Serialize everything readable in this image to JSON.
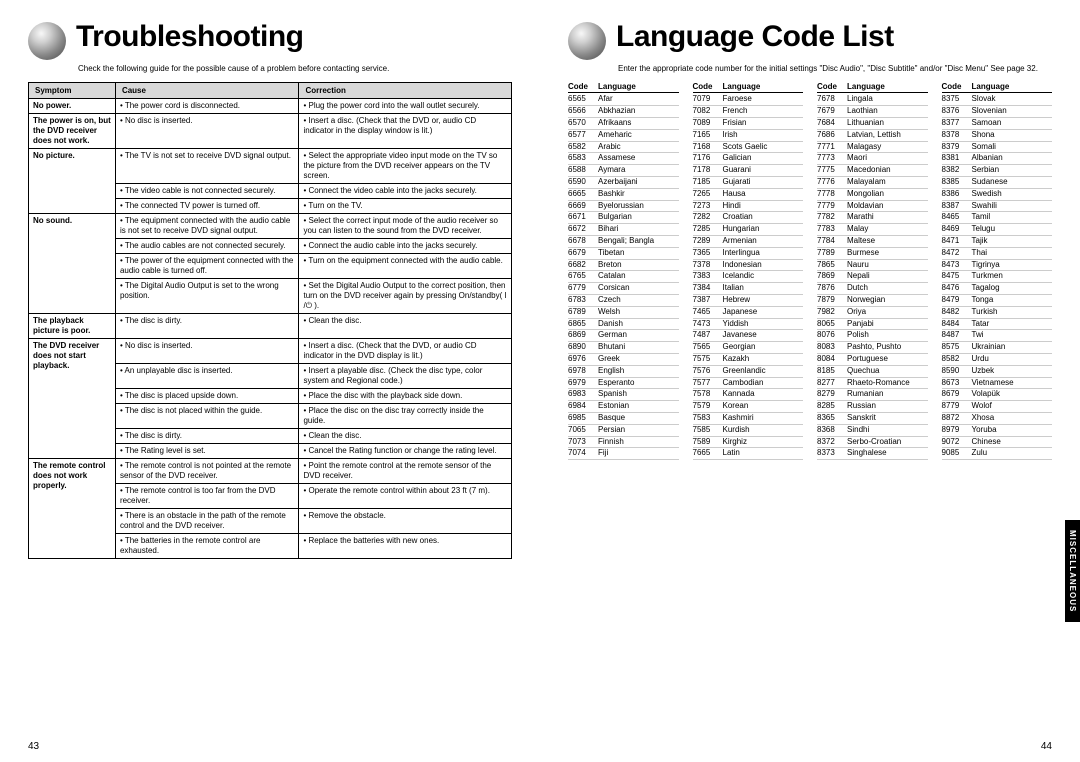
{
  "left": {
    "title": "Troubleshooting",
    "intro": "Check the following guide for the possible cause of a problem before contacting service.",
    "headers": {
      "symptom": "Symptom",
      "cause": "Cause",
      "correction": "Correction"
    },
    "rows": [
      {
        "symptom": "No power.",
        "items": [
          {
            "cause": "The power cord is disconnected.",
            "corr": "Plug the power cord into the wall outlet securely."
          }
        ]
      },
      {
        "symptom": "The power is on, but the DVD receiver does not work.",
        "items": [
          {
            "cause": "No disc is inserted.",
            "corr": "Insert a disc. (Check that the DVD or, audio CD indicator in the display window is lit.)"
          }
        ]
      },
      {
        "symptom": "No picture.",
        "items": [
          {
            "cause": "The TV is not set to receive DVD signal output.",
            "corr": "Select the appropriate video input mode on the TV so the picture from the DVD receiver appears on the TV screen."
          },
          {
            "cause": "The video cable is not connected securely.",
            "corr": "Connect the video cable into the jacks securely."
          },
          {
            "cause": "The connected TV power is turned off.",
            "corr": "Turn on the TV."
          }
        ]
      },
      {
        "symptom": "No sound.",
        "items": [
          {
            "cause": "The equipment connected with the audio cable is not set to receive DVD signal output.",
            "corr": "Select the correct input mode of the audio receiver so you can listen to the sound from the DVD receiver."
          },
          {
            "cause": "The audio cables are not connected securely.",
            "corr": "Connect the audio cable into the jacks securely."
          },
          {
            "cause": "The power of the equipment connected with the audio cable is turned off.",
            "corr": "Turn on the equipment connected with the audio cable."
          },
          {
            "cause": "The Digital Audio Output is set to the wrong position.",
            "corr": "Set the Digital Audio Output to the correct position, then turn on the DVD receiver again by pressing On/standby( I /⏻ )."
          }
        ]
      },
      {
        "symptom": "The playback picture is poor.",
        "items": [
          {
            "cause": "The disc is dirty.",
            "corr": "Clean the disc."
          }
        ]
      },
      {
        "symptom": "The DVD receiver does not start playback.",
        "items": [
          {
            "cause": "No disc is inserted.",
            "corr": "Insert a disc. (Check that the DVD, or audio CD indicator in the DVD display is lit.)"
          },
          {
            "cause": "An unplayable disc is inserted.",
            "corr": "Insert a playable disc. (Check the disc type, color system and Regional code.)"
          },
          {
            "cause": "The disc is placed upside down.",
            "corr": "Place the disc with the playback side down."
          },
          {
            "cause": "The disc is not placed within the guide.",
            "corr": "Place the disc on the disc tray correctly inside the guide."
          },
          {
            "cause": "The disc is dirty.",
            "corr": "Clean the disc."
          },
          {
            "cause": "The Rating level is set.",
            "corr": "Cancel the Rating function or change the rating  level."
          }
        ]
      },
      {
        "symptom": "The remote control does not work properly.",
        "items": [
          {
            "cause": "The remote control is not pointed at the remote sensor of the DVD receiver.",
            "corr": "Point the remote control at the remote sensor of the DVD receiver."
          },
          {
            "cause": "The remote control is too far from the DVD receiver.",
            "corr": "Operate the remote control within about 23 ft (7 m)."
          },
          {
            "cause": "There is an obstacle in the path of the remote control and the DVD receiver.",
            "corr": "Remove the obstacle."
          },
          {
            "cause": "The batteries in the remote control are exhausted.",
            "corr": "Replace the batteries with new ones."
          }
        ]
      }
    ],
    "pageNum": "43"
  },
  "right": {
    "title": "Language Code List",
    "intro": "Enter the appropriate code number for the initial settings \"Disc Audio\", \"Disc Subtitle\" and/or \"Disc Menu\"  See page 32.",
    "headers": {
      "code": "Code",
      "language": "Language"
    },
    "cols": [
      [
        {
          "c": "6565",
          "l": "Afar"
        },
        {
          "c": "6566",
          "l": "Abkhazian"
        },
        {
          "c": "6570",
          "l": "Afrikaans"
        },
        {
          "c": "6577",
          "l": "Ameharic"
        },
        {
          "c": "6582",
          "l": "Arabic"
        },
        {
          "c": "6583",
          "l": "Assamese"
        },
        {
          "c": "6588",
          "l": "Aymara"
        },
        {
          "c": "6590",
          "l": "Azerbaijani"
        },
        {
          "c": "6665",
          "l": "Bashkir"
        },
        {
          "c": "6669",
          "l": "Byelorussian"
        },
        {
          "c": "6671",
          "l": "Bulgarian"
        },
        {
          "c": "6672",
          "l": "Bihari"
        },
        {
          "c": "6678",
          "l": "Bengali; Bangla"
        },
        {
          "c": "6679",
          "l": "Tibetan"
        },
        {
          "c": "6682",
          "l": "Breton"
        },
        {
          "c": "6765",
          "l": "Catalan"
        },
        {
          "c": "6779",
          "l": "Corsican"
        },
        {
          "c": "6783",
          "l": "Czech"
        },
        {
          "c": "6789",
          "l": "Welsh"
        },
        {
          "c": "6865",
          "l": "Danish"
        },
        {
          "c": "6869",
          "l": "German"
        },
        {
          "c": "6890",
          "l": "Bhutani"
        },
        {
          "c": "6976",
          "l": "Greek"
        },
        {
          "c": "6978",
          "l": "English"
        },
        {
          "c": "6979",
          "l": "Esperanto"
        },
        {
          "c": "6983",
          "l": "Spanish"
        },
        {
          "c": "6984",
          "l": "Estonian"
        },
        {
          "c": "6985",
          "l": "Basque"
        },
        {
          "c": "7065",
          "l": "Persian"
        },
        {
          "c": "7073",
          "l": "Finnish"
        },
        {
          "c": "7074",
          "l": "Fiji"
        }
      ],
      [
        {
          "c": "7079",
          "l": "Faroese"
        },
        {
          "c": "7082",
          "l": "French"
        },
        {
          "c": "7089",
          "l": "Frisian"
        },
        {
          "c": "7165",
          "l": "Irish"
        },
        {
          "c": "7168",
          "l": "Scots Gaelic"
        },
        {
          "c": "7176",
          "l": "Galician"
        },
        {
          "c": "7178",
          "l": "Guarani"
        },
        {
          "c": "7185",
          "l": "Gujarati"
        },
        {
          "c": "7265",
          "l": "Hausa"
        },
        {
          "c": "7273",
          "l": "Hindi"
        },
        {
          "c": "7282",
          "l": "Croatian"
        },
        {
          "c": "7285",
          "l": "Hungarian"
        },
        {
          "c": "7289",
          "l": "Armenian"
        },
        {
          "c": "7365",
          "l": "Interlingua"
        },
        {
          "c": "7378",
          "l": "Indonesian"
        },
        {
          "c": "7383",
          "l": "Icelandic"
        },
        {
          "c": "7384",
          "l": "Italian"
        },
        {
          "c": "7387",
          "l": "Hebrew"
        },
        {
          "c": "7465",
          "l": "Japanese"
        },
        {
          "c": "7473",
          "l": "Yiddish"
        },
        {
          "c": "7487",
          "l": "Javanese"
        },
        {
          "c": "7565",
          "l": "Georgian"
        },
        {
          "c": "7575",
          "l": "Kazakh"
        },
        {
          "c": "7576",
          "l": "Greenlandic"
        },
        {
          "c": "7577",
          "l": "Cambodian"
        },
        {
          "c": "7578",
          "l": "Kannada"
        },
        {
          "c": "7579",
          "l": "Korean"
        },
        {
          "c": "7583",
          "l": "Kashmiri"
        },
        {
          "c": "7585",
          "l": "Kurdish"
        },
        {
          "c": "7589",
          "l": "Kirghiz"
        },
        {
          "c": "7665",
          "l": "Latin"
        }
      ],
      [
        {
          "c": "7678",
          "l": "Lingala"
        },
        {
          "c": "7679",
          "l": "Laothian"
        },
        {
          "c": "7684",
          "l": "Lithuanian"
        },
        {
          "c": "7686",
          "l": "Latvian, Lettish"
        },
        {
          "c": "7771",
          "l": "Malagasy"
        },
        {
          "c": "7773",
          "l": "Maori"
        },
        {
          "c": "7775",
          "l": "Macedonian"
        },
        {
          "c": "7776",
          "l": "Malayalam"
        },
        {
          "c": "7778",
          "l": "Mongolian"
        },
        {
          "c": "7779",
          "l": "Moldavian"
        },
        {
          "c": "7782",
          "l": "Marathi"
        },
        {
          "c": "7783",
          "l": "Malay"
        },
        {
          "c": "7784",
          "l": "Maltese"
        },
        {
          "c": "7789",
          "l": "Burmese"
        },
        {
          "c": "7865",
          "l": "Nauru"
        },
        {
          "c": "7869",
          "l": "Nepali"
        },
        {
          "c": "7876",
          "l": "Dutch"
        },
        {
          "c": "7879",
          "l": "Norwegian"
        },
        {
          "c": "7982",
          "l": "Oriya"
        },
        {
          "c": "8065",
          "l": "Panjabi"
        },
        {
          "c": "8076",
          "l": "Polish"
        },
        {
          "c": "8083",
          "l": "Pashto, Pushto"
        },
        {
          "c": "8084",
          "l": "Portuguese"
        },
        {
          "c": "8185",
          "l": "Quechua"
        },
        {
          "c": "8277",
          "l": "Rhaeto-Romance"
        },
        {
          "c": "8279",
          "l": "Rumanian"
        },
        {
          "c": "8285",
          "l": "Russian"
        },
        {
          "c": "8365",
          "l": "Sanskrit"
        },
        {
          "c": "8368",
          "l": "Sindhi"
        },
        {
          "c": "8372",
          "l": "Serbo-Croatian"
        },
        {
          "c": "8373",
          "l": "Singhalese"
        }
      ],
      [
        {
          "c": "8375",
          "l": "Slovak"
        },
        {
          "c": "8376",
          "l": "Slovenian"
        },
        {
          "c": "8377",
          "l": "Samoan"
        },
        {
          "c": "8378",
          "l": "Shona"
        },
        {
          "c": "8379",
          "l": "Somali"
        },
        {
          "c": "8381",
          "l": "Albanian"
        },
        {
          "c": "8382",
          "l": "Serbian"
        },
        {
          "c": "8385",
          "l": "Sudanese"
        },
        {
          "c": "8386",
          "l": "Swedish"
        },
        {
          "c": "8387",
          "l": "Swahili"
        },
        {
          "c": "8465",
          "l": "Tamil"
        },
        {
          "c": "8469",
          "l": "Telugu"
        },
        {
          "c": "8471",
          "l": "Tajik"
        },
        {
          "c": "8472",
          "l": "Thai"
        },
        {
          "c": "8473",
          "l": "Tigrinya"
        },
        {
          "c": "8475",
          "l": "Turkmen"
        },
        {
          "c": "8476",
          "l": "Tagalog"
        },
        {
          "c": "8479",
          "l": "Tonga"
        },
        {
          "c": "8482",
          "l": "Turkish"
        },
        {
          "c": "8484",
          "l": "Tatar"
        },
        {
          "c": "8487",
          "l": "Twi"
        },
        {
          "c": "8575",
          "l": "Ukrainian"
        },
        {
          "c": "8582",
          "l": "Urdu"
        },
        {
          "c": "8590",
          "l": "Uzbek"
        },
        {
          "c": "8673",
          "l": "Vietnamese"
        },
        {
          "c": "8679",
          "l": "Volapük"
        },
        {
          "c": "8779",
          "l": "Wolof"
        },
        {
          "c": "8872",
          "l": "Xhosa"
        },
        {
          "c": "8979",
          "l": "Yoruba"
        },
        {
          "c": "9072",
          "l": "Chinese"
        },
        {
          "c": "9085",
          "l": "Zulu"
        }
      ]
    ],
    "pageNum": "44",
    "sideTab": "MISCELLANEOUS"
  }
}
